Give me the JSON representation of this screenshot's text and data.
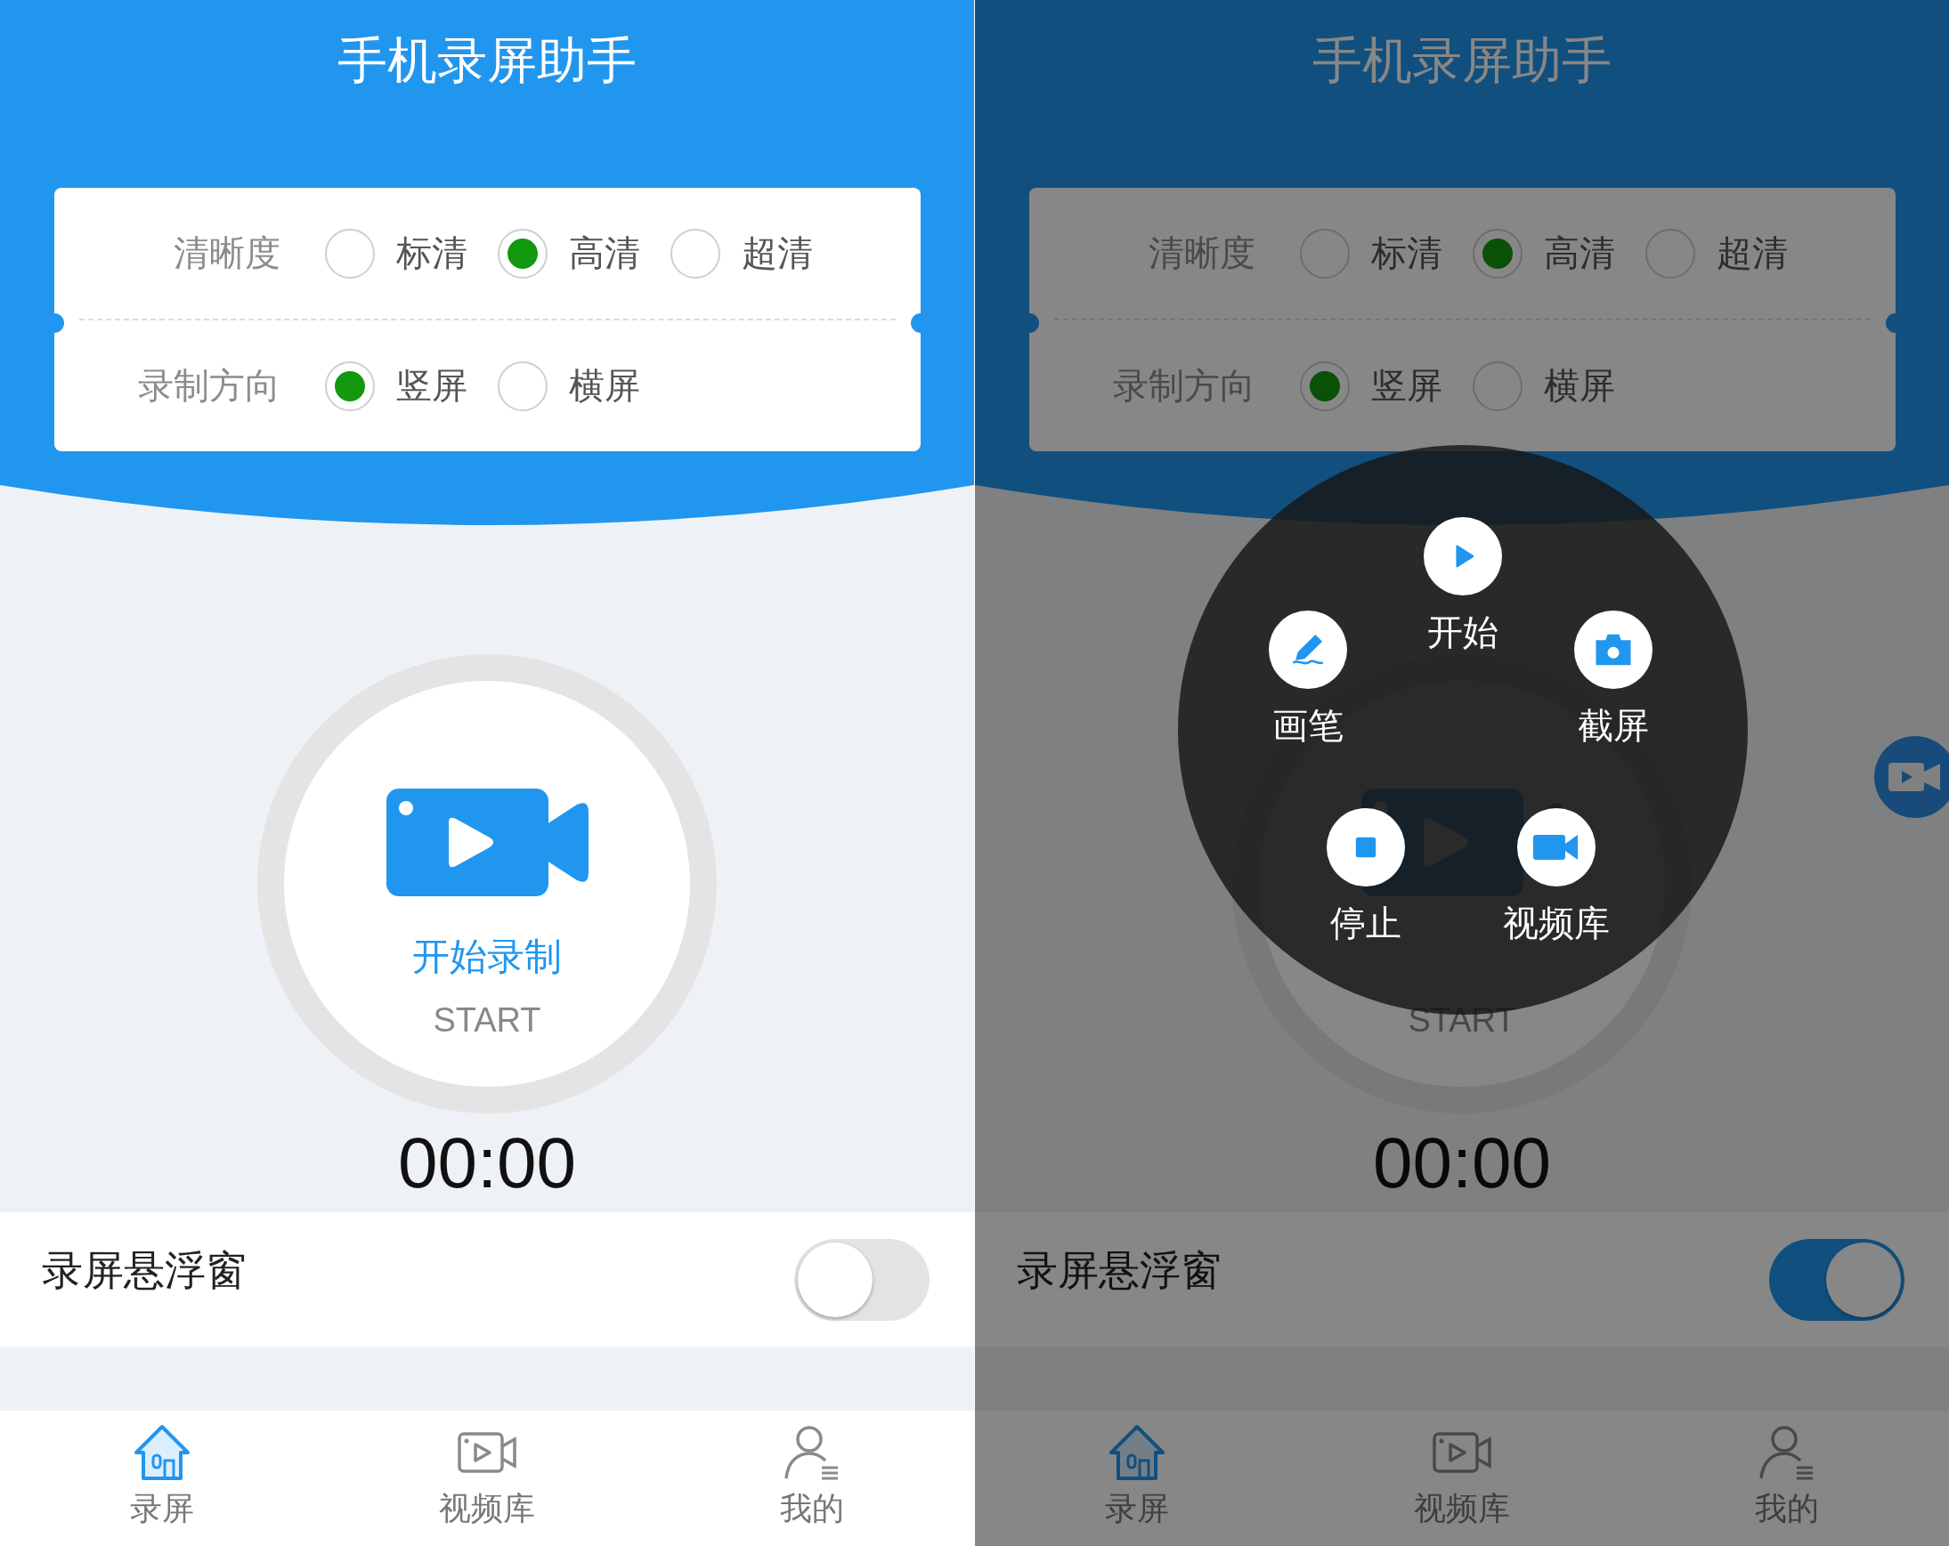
{
  "screens": [
    {
      "title": "手机录屏助手",
      "settings": [
        {
          "label": "清晰度",
          "options": [
            {
              "label": "标清",
              "selected": false
            },
            {
              "label": "高清",
              "selected": true
            },
            {
              "label": "超清",
              "selected": false
            }
          ]
        },
        {
          "label": "录制方向",
          "options": [
            {
              "label": "竖屏",
              "selected": true
            },
            {
              "label": "横屏",
              "selected": false
            }
          ]
        }
      ],
      "record_button": {
        "label": "开始录制",
        "sublabel": "START"
      },
      "timer": "00:00",
      "floating_window": {
        "label": "录屏悬浮窗",
        "on": false
      },
      "tabs": [
        {
          "kind": "home",
          "label": "录屏",
          "selected": true
        },
        {
          "kind": "video",
          "label": "视频库",
          "selected": false
        },
        {
          "kind": "profile",
          "label": "我的",
          "selected": false
        }
      ]
    },
    {
      "title": "手机录屏助手",
      "settings": [
        {
          "label": "清晰度",
          "options": [
            {
              "label": "标清",
              "selected": false
            },
            {
              "label": "高清",
              "selected": true
            },
            {
              "label": "超清",
              "selected": false
            }
          ]
        },
        {
          "label": "录制方向",
          "options": [
            {
              "label": "竖屏",
              "selected": true
            },
            {
              "label": "横屏",
              "selected": false
            }
          ]
        }
      ],
      "record_button": {
        "sublabel": "START"
      },
      "timer": "00:00",
      "floating_window": {
        "label": "录屏悬浮窗",
        "on": true
      },
      "tabs": [
        {
          "kind": "home",
          "label": "录屏",
          "selected": true
        },
        {
          "kind": "video",
          "label": "视频库",
          "selected": false
        },
        {
          "kind": "profile",
          "label": "我的",
          "selected": false
        }
      ],
      "float_menu": [
        {
          "kind": "start",
          "label": "开始"
        },
        {
          "kind": "pen",
          "label": "画笔"
        },
        {
          "kind": "screenshot",
          "label": "截屏"
        },
        {
          "kind": "stop",
          "label": "停止"
        },
        {
          "kind": "library",
          "label": "视频库"
        }
      ]
    }
  ]
}
